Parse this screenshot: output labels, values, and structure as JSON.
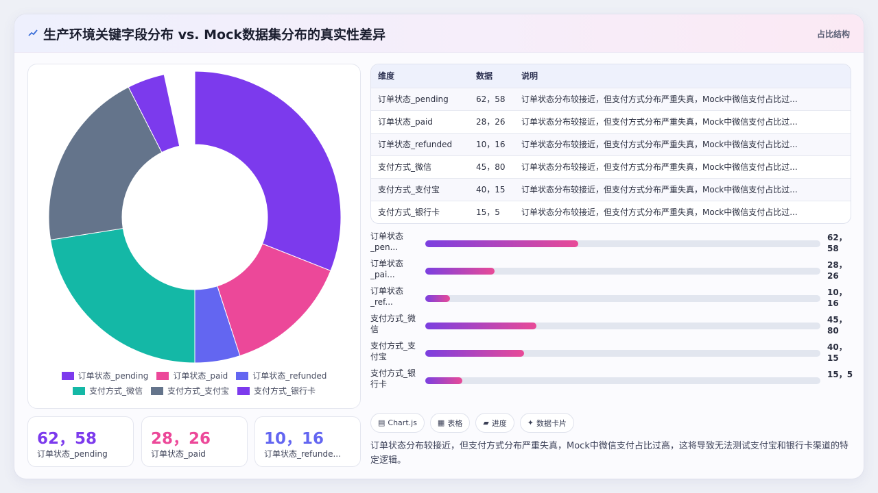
{
  "header": {
    "title": "生产环境关键字段分布 vs. Mock数据集分布的真实性差异",
    "tag": "占比结构"
  },
  "colors": {
    "purple": "#7c3aed",
    "pink": "#ec4899",
    "indigo": "#6366f1",
    "teal": "#14b8a6",
    "slate": "#64748b",
    "violet": "#7c3aed"
  },
  "chart_data": {
    "type": "pie",
    "subtype": "doughnut",
    "categories": [
      "订单状态_pending",
      "订单状态_paid",
      "订单状态_refunded",
      "支付方式_微信",
      "支付方式_支付宝",
      "支付方式_银行卡"
    ],
    "values": [
      62,
      28,
      10,
      45,
      40,
      15
    ],
    "colors": [
      "#7c3aed",
      "#ec4899",
      "#6366f1",
      "#14b8a6",
      "#64748b",
      "#7c3aed"
    ],
    "legend": "bottom",
    "missing_slice": "支付方式_银行卡 partially cropped at top"
  },
  "stats": [
    {
      "value": "62，58",
      "label": "订单状态_pending",
      "color": "#7c3aed"
    },
    {
      "value": "28，26",
      "label": "订单状态_paid",
      "color": "#ec4899"
    },
    {
      "value": "10，16",
      "label": "订单状态_refunde...",
      "color": "#6366f1"
    }
  ],
  "table": {
    "headers": [
      "维度",
      "数据",
      "说明"
    ],
    "rows": [
      {
        "dim": "订单状态_pending",
        "data": "62，58",
        "note": "订单状态分布较接近，但支付方式分布严重失真，Mock中微信支付占比过..."
      },
      {
        "dim": "订单状态_paid",
        "data": "28，26",
        "note": "订单状态分布较接近，但支付方式分布严重失真，Mock中微信支付占比过..."
      },
      {
        "dim": "订单状态_refunded",
        "data": "10，16",
        "note": "订单状态分布较接近，但支付方式分布严重失真，Mock中微信支付占比过..."
      },
      {
        "dim": "支付方式_微信",
        "data": "45，80",
        "note": "订单状态分布较接近，但支付方式分布严重失真，Mock中微信支付占比过..."
      },
      {
        "dim": "支付方式_支付宝",
        "data": "40，15",
        "note": "订单状态分布较接近，但支付方式分布严重失真，Mock中微信支付占比过..."
      },
      {
        "dim": "支付方式_银行卡",
        "data": "15，5",
        "note": "订单状态分布较接近，但支付方式分布严重失真，Mock中微信支付占比过..."
      }
    ]
  },
  "bars": [
    {
      "name": "订单状态_pen...",
      "num": "62，58",
      "fraction": 0.387
    },
    {
      "name": "订单状态_pai...",
      "num": "28，26",
      "fraction": 0.175
    },
    {
      "name": "订单状态_ref...",
      "num": "10，16",
      "fraction": 0.0625
    },
    {
      "name": "支付方式_微信",
      "num": "45，80",
      "fraction": 0.281
    },
    {
      "name": "支付方式_支付宝",
      "num": "40，15",
      "fraction": 0.25
    },
    {
      "name": "支付方式_银行卡",
      "num": "15，5",
      "fraction": 0.094
    }
  ],
  "chips": [
    {
      "icon": "chart-icon",
      "label": "Chart.js"
    },
    {
      "icon": "table-icon",
      "label": "表格"
    },
    {
      "icon": "progress-icon",
      "label": "进度"
    },
    {
      "icon": "sparkle-icon",
      "label": "数据卡片"
    }
  ],
  "summary": "订单状态分布较接近，但支付方式分布严重失真，Mock中微信支付占比过高，这将导致无法测试支付宝和银行卡渠道的特定逻辑。"
}
